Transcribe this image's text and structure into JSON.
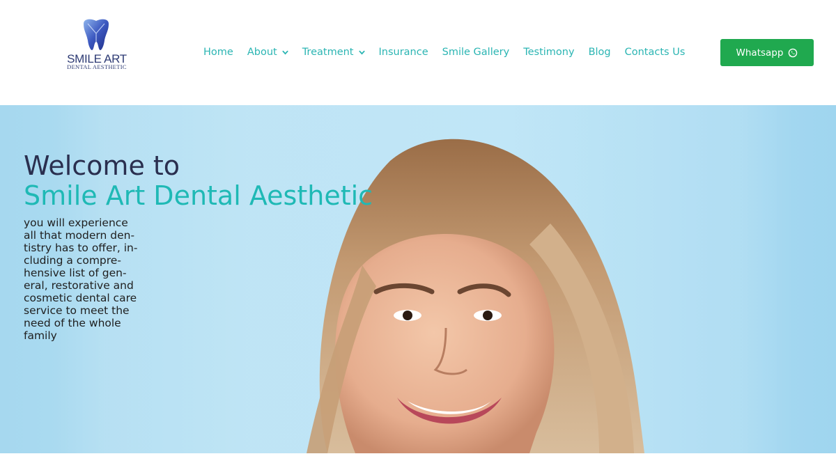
{
  "brand": {
    "name": "SMILE ART",
    "tagline": "DENTAL AESTHETIC"
  },
  "nav": {
    "items": [
      {
        "label": "Home",
        "dropdown": false
      },
      {
        "label": "About",
        "dropdown": true
      },
      {
        "label": "Treatment",
        "dropdown": true
      },
      {
        "label": "Insurance",
        "dropdown": false
      },
      {
        "label": "Smile Gallery",
        "dropdown": false
      },
      {
        "label": "Testimony",
        "dropdown": false
      },
      {
        "label": "Blog",
        "dropdown": false
      },
      {
        "label": "Contacts Us",
        "dropdown": false
      }
    ]
  },
  "cta": {
    "label": "Whatsapp",
    "icon": "whatsapp-icon",
    "color": "#20a94f"
  },
  "hero": {
    "title_line1": "Welcome to",
    "title_line2": "Smile Art Dental Aesthetic",
    "description": "you will experience all that modern den-tistry has to offer, in-cluding a compre-hensive list of gen-eral, restorative and cosmetic dental care service to meet the need of the whole family"
  },
  "colors": {
    "accent": "#2bb5b3",
    "title_dark": "#2a2f4f",
    "title_teal": "#1fb9b5",
    "hero_bg": "#b8e3f6"
  }
}
